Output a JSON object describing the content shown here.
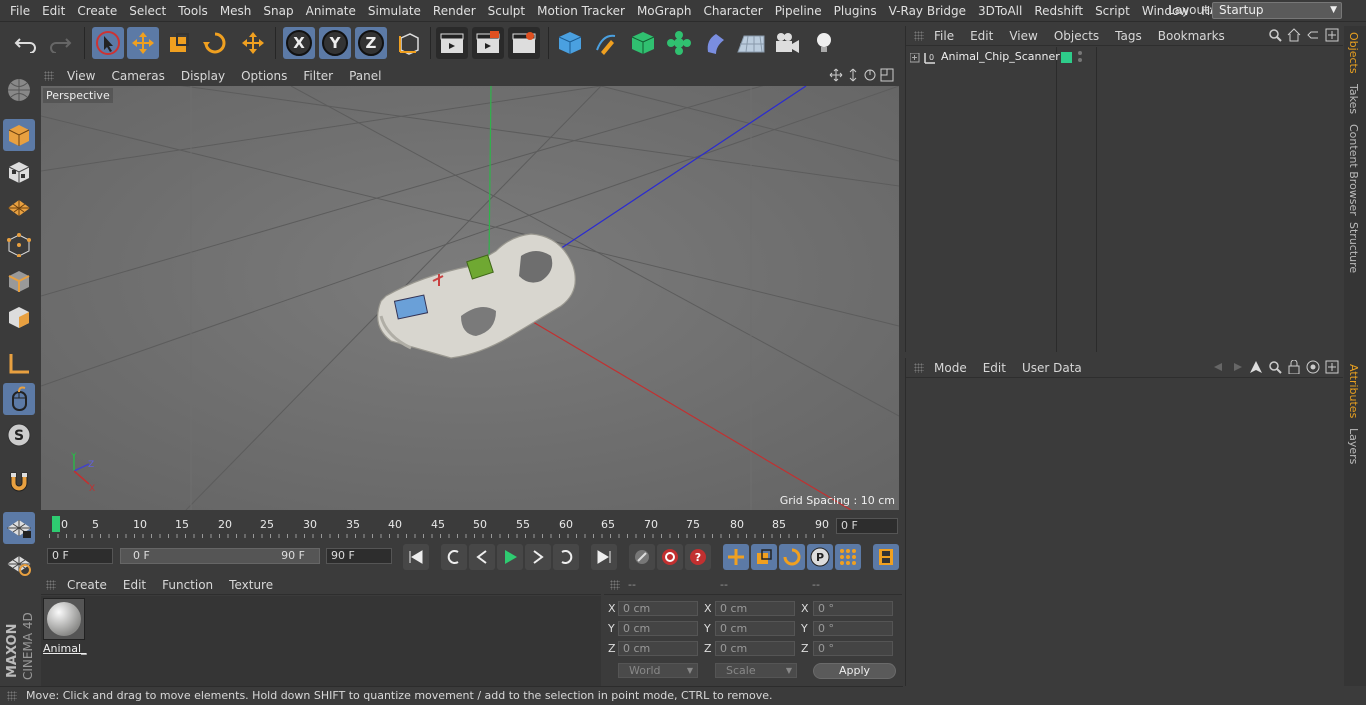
{
  "menubar": {
    "items": [
      "File",
      "Edit",
      "Create",
      "Select",
      "Tools",
      "Mesh",
      "Snap",
      "Animate",
      "Simulate",
      "Render",
      "Sculpt",
      "Motion Tracker",
      "MoGraph",
      "Character",
      "Pipeline",
      "Plugins",
      "V-Ray Bridge",
      "3DToAll",
      "Redshift",
      "Script",
      "Window",
      "Help"
    ],
    "layout_label": "Layout:",
    "layout_value": "Startup"
  },
  "viewport": {
    "menu": [
      "View",
      "Cameras",
      "Display",
      "Options",
      "Filter",
      "Panel"
    ],
    "label": "Perspective",
    "grid_spacing": "Grid Spacing : 10 cm"
  },
  "timeline": {
    "ticks": [
      "0",
      "5",
      "10",
      "15",
      "20",
      "25",
      "30",
      "35",
      "40",
      "45",
      "50",
      "55",
      "60",
      "65",
      "70",
      "75",
      "80",
      "85",
      "90"
    ],
    "current_frame": "0 F"
  },
  "transport": {
    "start_frame": "0 F",
    "range_start": "0 F",
    "range_end": "90 F",
    "end_frame": "90 F"
  },
  "material_manager": {
    "menu": [
      "Create",
      "Edit",
      "Function",
      "Texture"
    ],
    "materials": [
      {
        "name": "Animal_"
      }
    ]
  },
  "coordinates": {
    "headers": [
      "--",
      "--",
      "--"
    ],
    "rows": [
      {
        "axis": "X",
        "pos": "0 cm",
        "size_axis": "X",
        "size": "0 cm",
        "rot_axis": "X",
        "rot": "0 °"
      },
      {
        "axis": "Y",
        "pos": "0 cm",
        "size_axis": "Y",
        "size": "0 cm",
        "rot_axis": "Y",
        "rot": "0 °"
      },
      {
        "axis": "Z",
        "pos": "0 cm",
        "size_axis": "Z",
        "size": "0 cm",
        "rot_axis": "Z",
        "rot": "0 °"
      }
    ],
    "mode": "World",
    "size_mode": "Scale",
    "apply": "Apply"
  },
  "status": "Move: Click and drag to move elements. Hold down SHIFT to quantize movement / add to the selection in point mode, CTRL to remove.",
  "object_manager": {
    "menu": [
      "File",
      "Edit",
      "View",
      "Objects",
      "Tags",
      "Bookmarks"
    ],
    "objects": [
      {
        "name": "Animal_Chip_Scanner",
        "tag_color": "#2ecc8a"
      }
    ]
  },
  "attribute_manager": {
    "menu": [
      "Mode",
      "Edit",
      "User Data"
    ]
  },
  "right_tabs": [
    "Objects",
    "Takes",
    "Content Browser",
    "Structure",
    "Attributes",
    "Layers"
  ],
  "logo": {
    "brand": "MAXON",
    "product": "CINEMA 4D"
  },
  "colors": {
    "accent": "#5c7aa6",
    "active_tab": "#e8a020",
    "timeline_marker": "#2ecc71"
  }
}
